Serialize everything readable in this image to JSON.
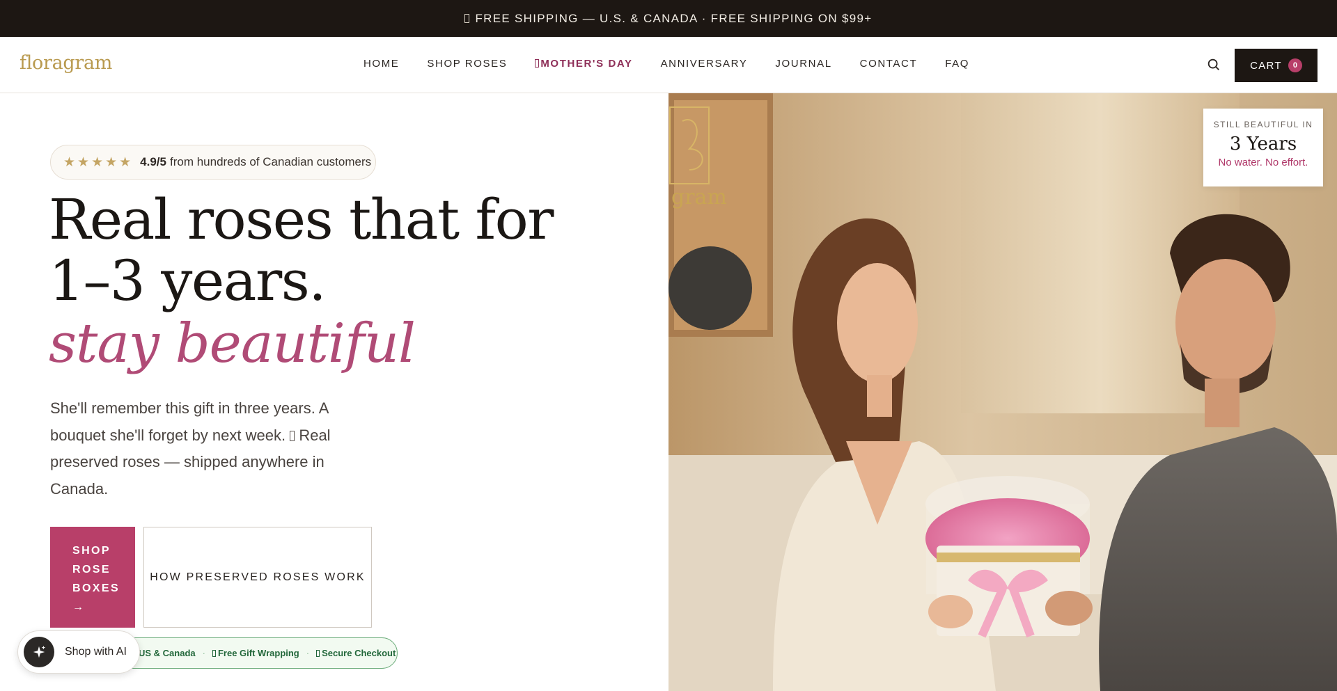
{
  "announcement": {
    "text": "FREE SHIPPING — U.S. & CANADA · FREE SHIPPING ON $99+"
  },
  "header": {
    "logo": "floragram",
    "nav": {
      "home": "HOME",
      "shop_roses": "SHOP ROSES",
      "mothers_day": "MOTHER'S DAY",
      "anniversary": "ANNIVERSARY",
      "journal": "JOURNAL",
      "contact": "CONTACT",
      "faq": "FAQ"
    },
    "cart_label": "CART",
    "cart_count": "0"
  },
  "hero": {
    "rating": {
      "stars": "★★★★★",
      "score": "4.9/5",
      "text": "from hundreds of Canadian customers"
    },
    "headline": "Real roses that for 1–3 years.",
    "headline_accent": "stay beautiful",
    "subcopy_part1": "She'll remember this gift in three years. A bouquet she'll forget by next week.",
    "subcopy_part2": "Real preserved roses — shipped anywhere in Canada.",
    "primary_cta": {
      "line1": "SHOP",
      "line2": "ROSE",
      "line3": "BOXES",
      "arrow": "→"
    },
    "secondary_cta": "HOW PRESERVED ROSES WORK",
    "trust": {
      "shipping": "US & Canada",
      "gift_wrap": "Free Gift Wrapping",
      "checkout": "Secure Checkout"
    },
    "photo_logo_text": "gram",
    "badge": {
      "label": "STILL BEAUTIFUL IN",
      "value": "3 Years",
      "note": "No water. No effort."
    }
  },
  "ai_widget": {
    "label": "Shop with AI"
  },
  "colors": {
    "accent": "#b83f69",
    "dark": "#1d1713",
    "gold": "#b99a4f",
    "success": "#22673a"
  }
}
